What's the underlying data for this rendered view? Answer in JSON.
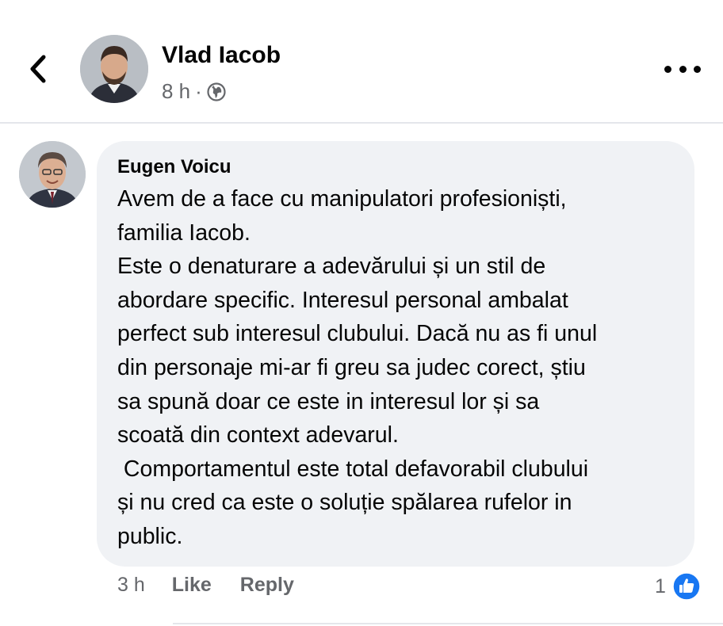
{
  "post": {
    "author_name": "Vlad Iacob",
    "time": "8 h",
    "separator": "·",
    "audience_icon": "globe-icon"
  },
  "comment": {
    "author_name": "Eugen Voicu",
    "lines": [
      "Avem de a face cu manipulatori profesioniști,",
      "familia Iacob.",
      "Este o denaturare a adevărului și un stil de",
      "abordare specific. Interesul personal ambalat",
      "perfect sub interesul clubului. Dacă nu as fi unul",
      "din personaje mi-ar fi greu sa judec corect, știu",
      "sa spună doar ce este in interesul lor și sa",
      "scoată din context adevarul.",
      " Comportamentul este total defavorabil clubului",
      "și nu cred ca este o soluție spălarea rufelor in",
      "public."
    ],
    "time": "3 h",
    "like_label": "Like",
    "reply_label": "Reply",
    "reaction_count": "1"
  },
  "colors": {
    "bubble": "#f0f2f5",
    "secondary_text": "#65676b",
    "like_blue": "#1877f2"
  }
}
